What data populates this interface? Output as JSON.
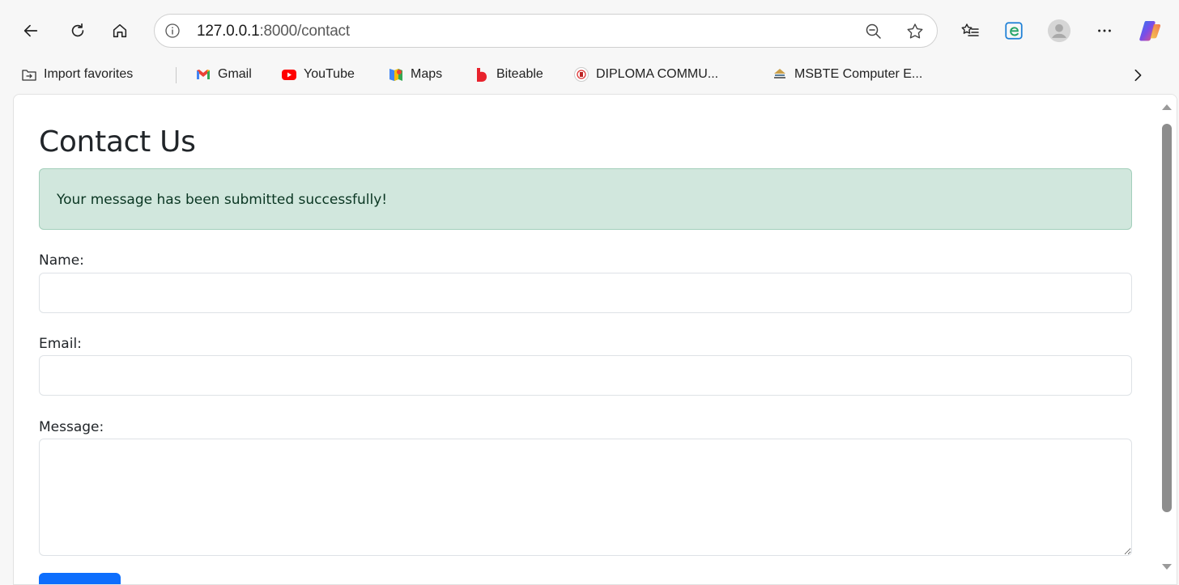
{
  "browser": {
    "url_host": "127.0.0.1",
    "url_rest": ":8000/contact"
  },
  "icons": {
    "back": "back-arrow-icon",
    "refresh": "refresh-icon",
    "home": "home-icon",
    "info": "info-icon",
    "zoom": "zoom-out-icon",
    "favorite": "star-icon",
    "favorites_list": "favorites-list-icon",
    "collections": "edge-icon",
    "profile": "profile-avatar-icon",
    "more": "more-options-icon",
    "copilot": "copilot-icon"
  },
  "favorites": [
    {
      "label": "Import favorites",
      "icon": "import-icon"
    },
    {
      "label": "Gmail",
      "icon": "gmail-icon"
    },
    {
      "label": "YouTube",
      "icon": "youtube-icon"
    },
    {
      "label": "Maps",
      "icon": "maps-icon"
    },
    {
      "label": "Biteable",
      "icon": "biteable-icon"
    },
    {
      "label": "DIPLOMA COMMU...",
      "icon": "diploma-icon"
    },
    {
      "label": "MSBTE Computer E...",
      "icon": "msbte-icon"
    }
  ],
  "page": {
    "title": "Contact Us",
    "alert": "Your message has been submitted successfully!",
    "labels": {
      "name": "Name:",
      "email": "Email:",
      "message": "Message:"
    }
  },
  "colors": {
    "alert_bg": "#d1e7dd",
    "alert_text": "#0a3622",
    "primary": "#0d6efd"
  }
}
